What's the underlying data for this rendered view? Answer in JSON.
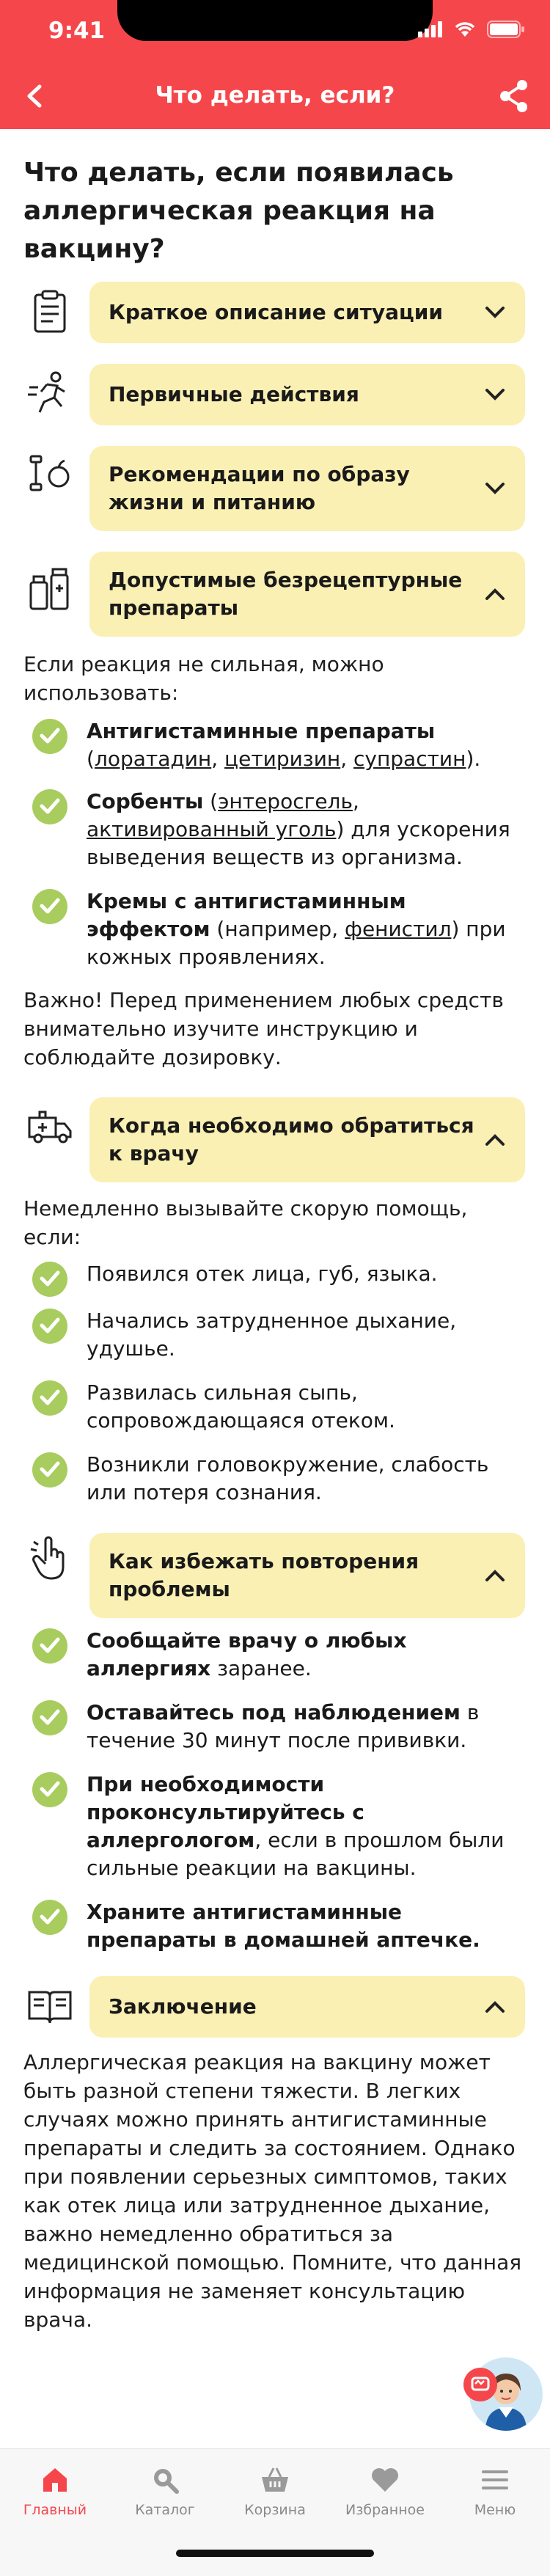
{
  "status": {
    "time": "9:41"
  },
  "nav": {
    "title": "Что делать, если?"
  },
  "page": {
    "title": "Что делать, если появилась аллергическая реакция на вакцину?"
  },
  "sections": [
    {
      "label": "Краткое описание ситуации",
      "icon": "clipboard-icon",
      "state": "collapsed"
    },
    {
      "label": "Первичные действия",
      "icon": "runner-icon",
      "state": "collapsed"
    },
    {
      "label": "Рекомендации по образу жизни и питанию",
      "icon": "dumbbell-apple-icon",
      "state": "collapsed"
    },
    {
      "label": "Допустимые безрецептурные препараты",
      "icon": "medicine-icon",
      "state": "expanded"
    },
    {
      "label": "Когда необходимо обратиться к врачу",
      "icon": "ambulance-icon",
      "state": "expanded"
    },
    {
      "label": "Как избежать повторения проблемы",
      "icon": "hand-pointer-icon",
      "state": "expanded"
    },
    {
      "label": "Заключение",
      "icon": "book-icon",
      "state": "expanded"
    }
  ],
  "otc": {
    "intro": "Если реакция не сильная, можно использовать:",
    "items": [
      {
        "bold": "Антигистаминные препараты",
        "pre": " (",
        "links": [
          "лоратадин",
          "цетиризин",
          "супрастин"
        ],
        "post": ")."
      },
      {
        "bold": "Сорбенты",
        "pre": " (",
        "links": [
          "энтеросгель",
          "активированный уголь"
        ],
        "post": ") для ускорения выведения веществ из организма."
      },
      {
        "bold": "Кремы с антигистаминным эффектом",
        "pre": " (например, ",
        "links": [
          "фенистил"
        ],
        "post": ") при кожных проявлениях."
      }
    ],
    "note": "Важно! Перед применением любых средств внимательно изучите инструкцию и соблюдайте дозировку."
  },
  "doctor": {
    "intro": "Немедленно вызывайте скорую помощь, если:",
    "items": [
      "Появился отек лица, губ, языка.",
      "Начались затрудненное дыхание, удушье.",
      "Развилась сильная сыпь, сопровождающаяся отеком.",
      "Возникли головокружение, слабость или потеря сознания."
    ]
  },
  "prevent": {
    "items": [
      {
        "bold": "Сообщайте врачу о любых аллергиях",
        "rest": " заранее."
      },
      {
        "bold": "Оставайтесь под наблюдением",
        "rest": " в течение 30 минут после прививки."
      },
      {
        "bold": "При необходимости проконсультируйтесь с аллергологом",
        "rest": ", если в прошлом были сильные реакции на вакцины."
      },
      {
        "bold": "Храните антигистаминные препараты в домашней аптечке.",
        "rest": ""
      }
    ]
  },
  "conclusion": {
    "text": "Аллергическая реакция на вакцину может быть разной степени тяжести. В легких случаях можно принять антигистаминные препараты и следить за состоянием. Однако при появлении серьезных симптомов, таких как отек лица или затрудненное дыхание, важно немедленно обратиться за медицинской помощью. Помните, что данная информация не заменяет консультацию врача."
  },
  "tabbar": [
    {
      "label": "Главный",
      "icon": "home-icon",
      "active": true
    },
    {
      "label": "Каталог",
      "icon": "search-icon",
      "active": false
    },
    {
      "label": "Корзина",
      "icon": "basket-icon",
      "active": false
    },
    {
      "label": "Избранное",
      "icon": "heart-icon",
      "active": false
    },
    {
      "label": "Меню",
      "icon": "menu-icon",
      "active": false
    }
  ],
  "colors": {
    "brand": "#f5474b",
    "accordion": "#fbf0b3",
    "check": "#a8cc5e"
  }
}
